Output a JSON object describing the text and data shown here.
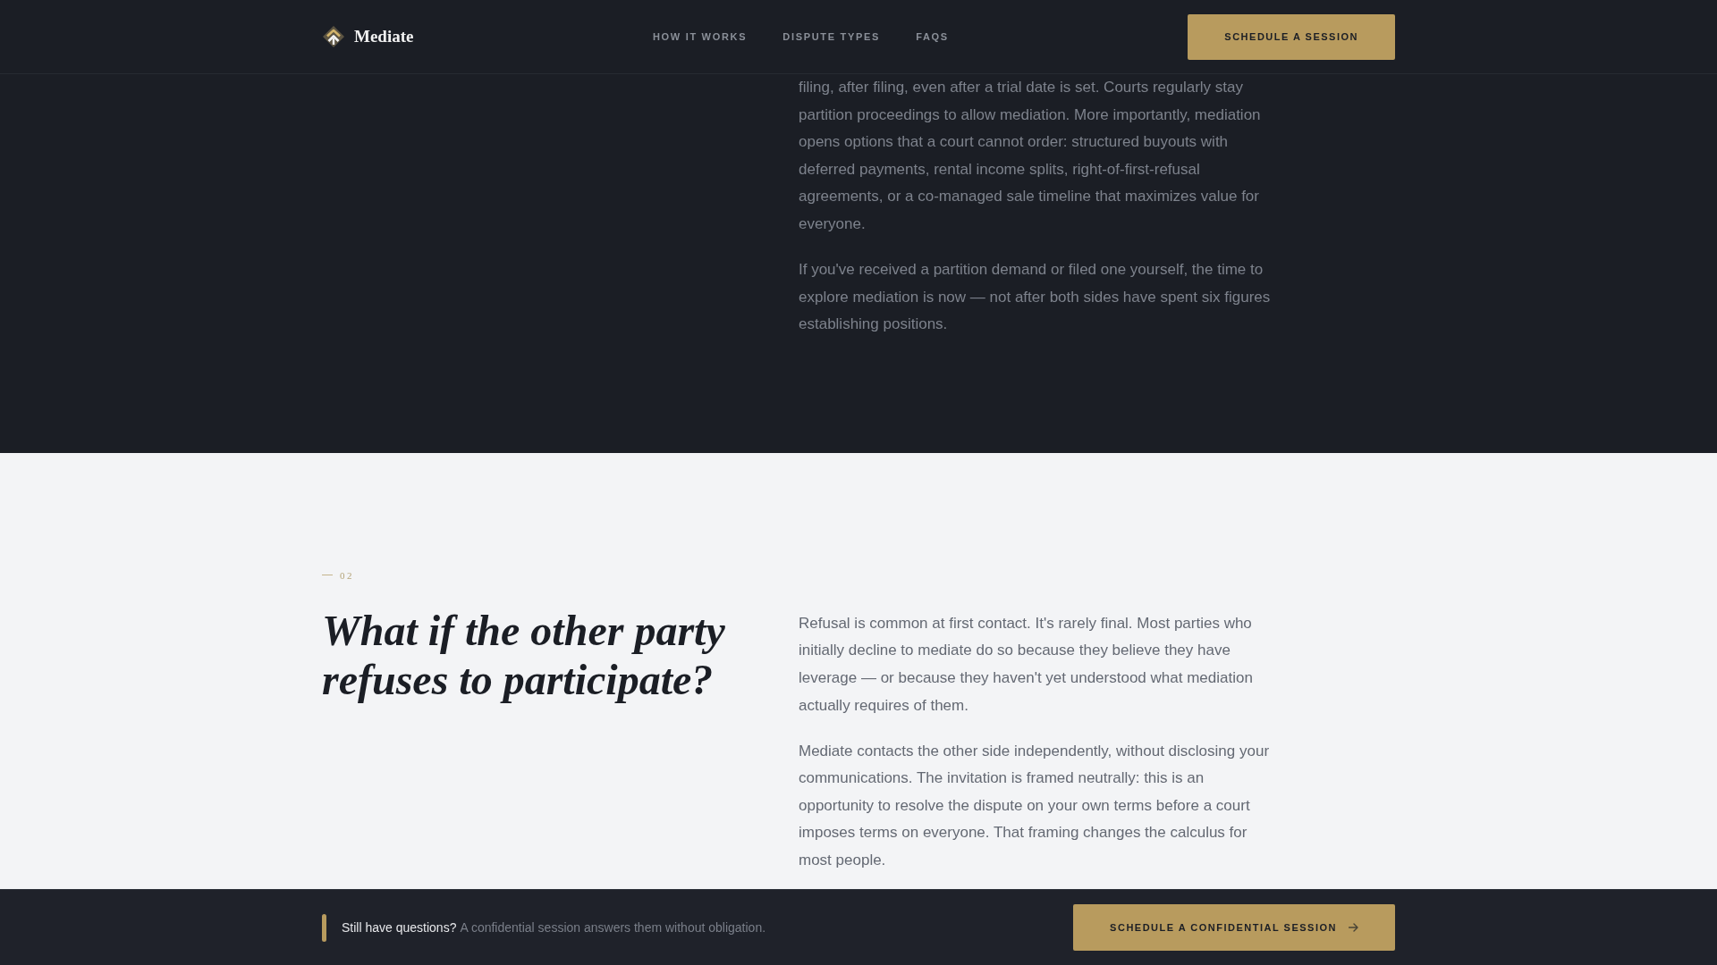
{
  "header": {
    "brand": "Mediate",
    "nav": [
      "HOW IT WORKS",
      "DISPUTE TYPES",
      "FAQS"
    ],
    "cta": "SCHEDULE A SESSION"
  },
  "sections": [
    {
      "kind": "dark",
      "paragraphs": [
        "filing, after filing, even after a trial date is set. Courts regularly stay partition proceedings to allow mediation. More importantly, mediation opens options that a court cannot order: structured buyouts with deferred payments, rental income splits, right-of-first-refusal agreements, or a co-managed sale timeline that maximizes value for everyone.",
        "If you've received a partition demand or filed one yourself, the time to explore mediation is now — not after both sides have spent six figures establishing positions."
      ]
    },
    {
      "kind": "light",
      "number": "02",
      "heading": "What if the other party refuses to participate?",
      "paragraphs": [
        "Refusal is common at first contact. It's rarely final. Most parties who initially decline to mediate do so because they believe they have leverage — or because they haven't yet understood what mediation actually requires of them.",
        "Mediate contacts the other side independently, without disclosing your communications. The invitation is framed neutrally: this is an opportunity to resolve the dispute on your own terms before a court imposes terms on everyone. That framing changes the calculus for most people."
      ]
    }
  ],
  "bottom_bar": {
    "prompt": "Still have questions?",
    "note": "A confidential session answers them without obligation.",
    "cta": "SCHEDULE A CONFIDENTIAL SESSION"
  }
}
